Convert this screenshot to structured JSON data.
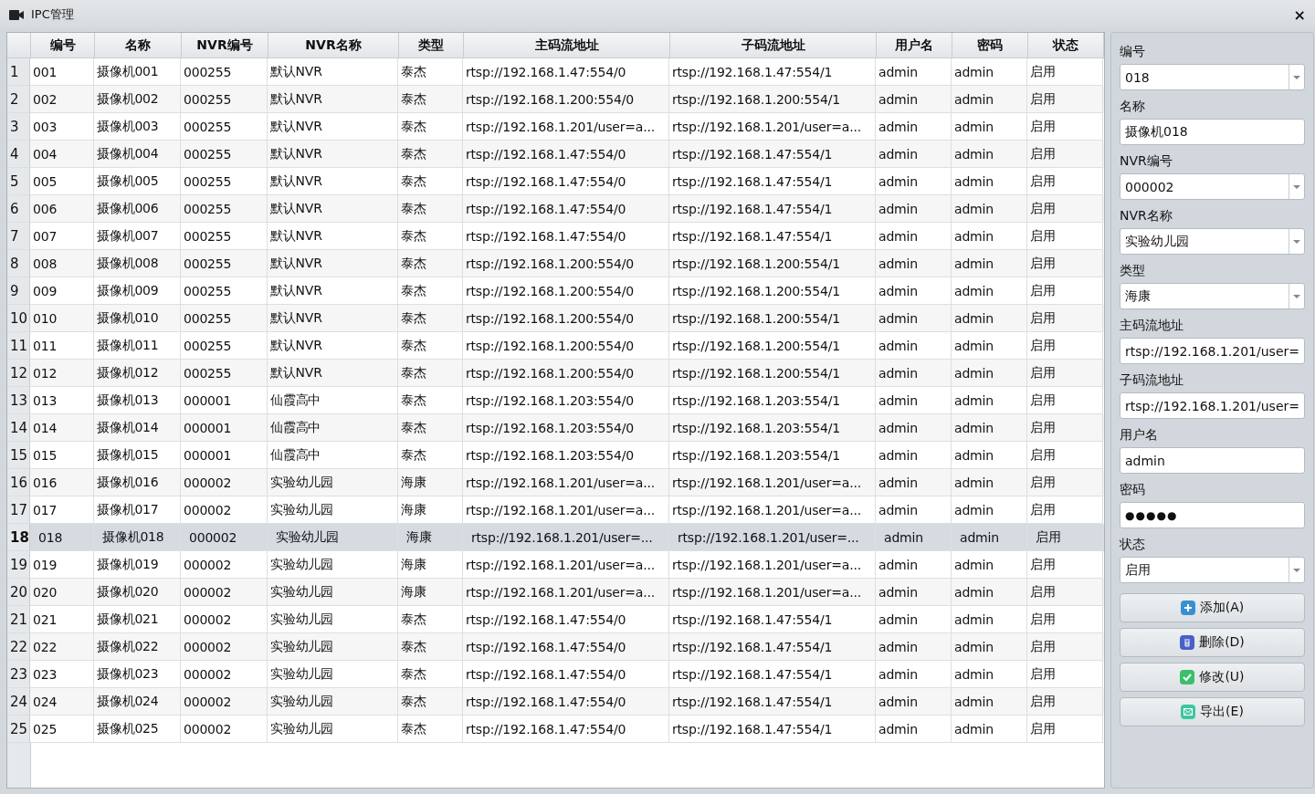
{
  "window": {
    "title": "IPC管理",
    "close": "×"
  },
  "table": {
    "columns": [
      "编号",
      "名称",
      "NVR编号",
      "NVR名称",
      "类型",
      "主码流地址",
      "子码流地址",
      "用户名",
      "密码",
      "状态"
    ],
    "rows": [
      {
        "index": "1",
        "selected": false,
        "cells": [
          "001",
          "摄像机001",
          "000255",
          "默认NVR",
          "泰杰",
          "rtsp://192.168.1.47:554/0",
          "rtsp://192.168.1.47:554/1",
          "admin",
          "admin",
          "启用"
        ]
      },
      {
        "index": "2",
        "selected": false,
        "cells": [
          "002",
          "摄像机002",
          "000255",
          "默认NVR",
          "泰杰",
          "rtsp://192.168.1.200:554/0",
          "rtsp://192.168.1.200:554/1",
          "admin",
          "admin",
          "启用"
        ]
      },
      {
        "index": "3",
        "selected": false,
        "cells": [
          "003",
          "摄像机003",
          "000255",
          "默认NVR",
          "泰杰",
          "rtsp://192.168.1.201/user=a...",
          "rtsp://192.168.1.201/user=a...",
          "admin",
          "admin",
          "启用"
        ]
      },
      {
        "index": "4",
        "selected": false,
        "cells": [
          "004",
          "摄像机004",
          "000255",
          "默认NVR",
          "泰杰",
          "rtsp://192.168.1.47:554/0",
          "rtsp://192.168.1.47:554/1",
          "admin",
          "admin",
          "启用"
        ]
      },
      {
        "index": "5",
        "selected": false,
        "cells": [
          "005",
          "摄像机005",
          "000255",
          "默认NVR",
          "泰杰",
          "rtsp://192.168.1.47:554/0",
          "rtsp://192.168.1.47:554/1",
          "admin",
          "admin",
          "启用"
        ]
      },
      {
        "index": "6",
        "selected": false,
        "cells": [
          "006",
          "摄像机006",
          "000255",
          "默认NVR",
          "泰杰",
          "rtsp://192.168.1.47:554/0",
          "rtsp://192.168.1.47:554/1",
          "admin",
          "admin",
          "启用"
        ]
      },
      {
        "index": "7",
        "selected": false,
        "cells": [
          "007",
          "摄像机007",
          "000255",
          "默认NVR",
          "泰杰",
          "rtsp://192.168.1.47:554/0",
          "rtsp://192.168.1.47:554/1",
          "admin",
          "admin",
          "启用"
        ]
      },
      {
        "index": "8",
        "selected": false,
        "cells": [
          "008",
          "摄像机008",
          "000255",
          "默认NVR",
          "泰杰",
          "rtsp://192.168.1.200:554/0",
          "rtsp://192.168.1.200:554/1",
          "admin",
          "admin",
          "启用"
        ]
      },
      {
        "index": "9",
        "selected": false,
        "cells": [
          "009",
          "摄像机009",
          "000255",
          "默认NVR",
          "泰杰",
          "rtsp://192.168.1.200:554/0",
          "rtsp://192.168.1.200:554/1",
          "admin",
          "admin",
          "启用"
        ]
      },
      {
        "index": "10",
        "selected": false,
        "cells": [
          "010",
          "摄像机010",
          "000255",
          "默认NVR",
          "泰杰",
          "rtsp://192.168.1.200:554/0",
          "rtsp://192.168.1.200:554/1",
          "admin",
          "admin",
          "启用"
        ]
      },
      {
        "index": "11",
        "selected": false,
        "cells": [
          "011",
          "摄像机011",
          "000255",
          "默认NVR",
          "泰杰",
          "rtsp://192.168.1.200:554/0",
          "rtsp://192.168.1.200:554/1",
          "admin",
          "admin",
          "启用"
        ]
      },
      {
        "index": "12",
        "selected": false,
        "cells": [
          "012",
          "摄像机012",
          "000255",
          "默认NVR",
          "泰杰",
          "rtsp://192.168.1.200:554/0",
          "rtsp://192.168.1.200:554/1",
          "admin",
          "admin",
          "启用"
        ]
      },
      {
        "index": "13",
        "selected": false,
        "cells": [
          "013",
          "摄像机013",
          "000001",
          "仙霞高中",
          "泰杰",
          "rtsp://192.168.1.203:554/0",
          "rtsp://192.168.1.203:554/1",
          "admin",
          "admin",
          "启用"
        ]
      },
      {
        "index": "14",
        "selected": false,
        "cells": [
          "014",
          "摄像机014",
          "000001",
          "仙霞高中",
          "泰杰",
          "rtsp://192.168.1.203:554/0",
          "rtsp://192.168.1.203:554/1",
          "admin",
          "admin",
          "启用"
        ]
      },
      {
        "index": "15",
        "selected": false,
        "cells": [
          "015",
          "摄像机015",
          "000001",
          "仙霞高中",
          "泰杰",
          "rtsp://192.168.1.203:554/0",
          "rtsp://192.168.1.203:554/1",
          "admin",
          "admin",
          "启用"
        ]
      },
      {
        "index": "16",
        "selected": false,
        "cells": [
          "016",
          "摄像机016",
          "000002",
          "实验幼儿园",
          "海康",
          "rtsp://192.168.1.201/user=a...",
          "rtsp://192.168.1.201/user=a...",
          "admin",
          "admin",
          "启用"
        ]
      },
      {
        "index": "17",
        "selected": false,
        "cells": [
          "017",
          "摄像机017",
          "000002",
          "实验幼儿园",
          "海康",
          "rtsp://192.168.1.201/user=a...",
          "rtsp://192.168.1.201/user=a...",
          "admin",
          "admin",
          "启用"
        ]
      },
      {
        "index": "18",
        "selected": true,
        "cells": [
          "018",
          "摄像机018",
          "000002",
          "实验幼儿园",
          "海康",
          "rtsp://192.168.1.201/user=...",
          "rtsp://192.168.1.201/user=...",
          "admin",
          "admin",
          "启用"
        ]
      },
      {
        "index": "19",
        "selected": false,
        "cells": [
          "019",
          "摄像机019",
          "000002",
          "实验幼儿园",
          "海康",
          "rtsp://192.168.1.201/user=a...",
          "rtsp://192.168.1.201/user=a...",
          "admin",
          "admin",
          "启用"
        ]
      },
      {
        "index": "20",
        "selected": false,
        "cells": [
          "020",
          "摄像机020",
          "000002",
          "实验幼儿园",
          "海康",
          "rtsp://192.168.1.201/user=a...",
          "rtsp://192.168.1.201/user=a...",
          "admin",
          "admin",
          "启用"
        ]
      },
      {
        "index": "21",
        "selected": false,
        "cells": [
          "021",
          "摄像机021",
          "000002",
          "实验幼儿园",
          "泰杰",
          "rtsp://192.168.1.47:554/0",
          "rtsp://192.168.1.47:554/1",
          "admin",
          "admin",
          "启用"
        ]
      },
      {
        "index": "22",
        "selected": false,
        "cells": [
          "022",
          "摄像机022",
          "000002",
          "实验幼儿园",
          "泰杰",
          "rtsp://192.168.1.47:554/0",
          "rtsp://192.168.1.47:554/1",
          "admin",
          "admin",
          "启用"
        ]
      },
      {
        "index": "23",
        "selected": false,
        "cells": [
          "023",
          "摄像机023",
          "000002",
          "实验幼儿园",
          "泰杰",
          "rtsp://192.168.1.47:554/0",
          "rtsp://192.168.1.47:554/1",
          "admin",
          "admin",
          "启用"
        ]
      },
      {
        "index": "24",
        "selected": false,
        "cells": [
          "024",
          "摄像机024",
          "000002",
          "实验幼儿园",
          "泰杰",
          "rtsp://192.168.1.47:554/0",
          "rtsp://192.168.1.47:554/1",
          "admin",
          "admin",
          "启用"
        ]
      },
      {
        "index": "25",
        "selected": false,
        "cells": [
          "025",
          "摄像机025",
          "000002",
          "实验幼儿园",
          "泰杰",
          "rtsp://192.168.1.47:554/0",
          "rtsp://192.168.1.47:554/1",
          "admin",
          "admin",
          "启用"
        ]
      }
    ]
  },
  "form": {
    "fields": [
      {
        "label": "编号",
        "value": "018",
        "kind": "combo"
      },
      {
        "label": "名称",
        "value": "摄像机018",
        "kind": "text"
      },
      {
        "label": "NVR编号",
        "value": "000002",
        "kind": "combo"
      },
      {
        "label": "NVR名称",
        "value": "实验幼儿园",
        "kind": "combo"
      },
      {
        "label": "类型",
        "value": "海康",
        "kind": "combo"
      },
      {
        "label": "主码流地址",
        "value": "rtsp://192.168.1.201/user=",
        "kind": "text"
      },
      {
        "label": "子码流地址",
        "value": "rtsp://192.168.1.201/user=",
        "kind": "text"
      },
      {
        "label": "用户名",
        "value": "admin",
        "kind": "text"
      },
      {
        "label": "密码",
        "value": "●●●●●",
        "kind": "password"
      },
      {
        "label": "状态",
        "value": "启用",
        "kind": "combo"
      }
    ],
    "buttons": [
      {
        "label": "添加(A)",
        "kind": "add"
      },
      {
        "label": "删除(D)",
        "kind": "delete"
      },
      {
        "label": "修改(U)",
        "kind": "edit"
      },
      {
        "label": "导出(E)",
        "kind": "export"
      }
    ]
  }
}
